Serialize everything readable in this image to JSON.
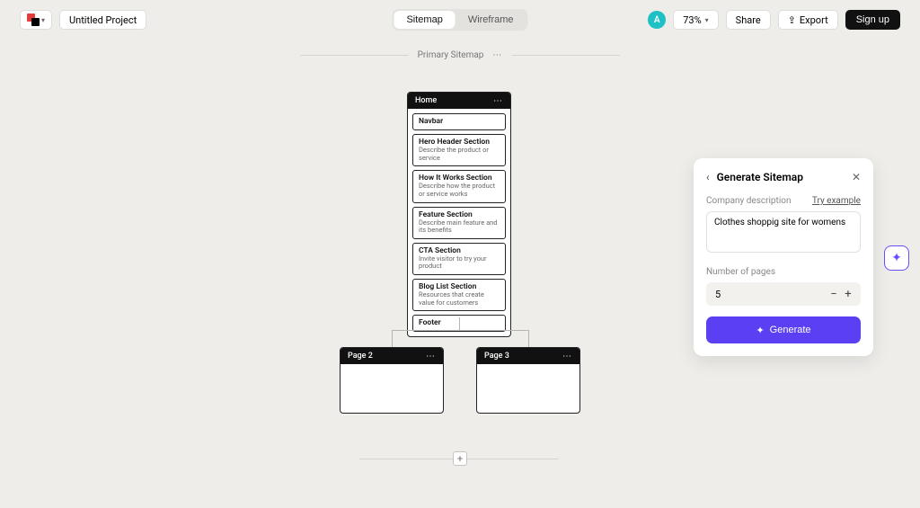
{
  "header": {
    "project_name": "Untitled Project",
    "mode_sitemap": "Sitemap",
    "mode_wireframe": "Wireframe",
    "avatar_initial": "A",
    "zoom_label": "73%",
    "share_label": "Share",
    "export_label": "Export",
    "signup_label": "Sign up"
  },
  "canvas": {
    "primary_label": "Primary Sitemap"
  },
  "home": {
    "title": "Home",
    "sections": [
      {
        "title": "Navbar",
        "desc": ""
      },
      {
        "title": "Hero Header Section",
        "desc": "Describe the product or service"
      },
      {
        "title": "How It Works Section",
        "desc": "Describe how the product or service works"
      },
      {
        "title": "Feature Section",
        "desc": "Describe main feature and its benefits"
      },
      {
        "title": "CTA Section",
        "desc": "Invite visitor to try your product"
      },
      {
        "title": "Blog List Section",
        "desc": "Resources that create value for customers"
      },
      {
        "title": "Footer",
        "desc": ""
      }
    ]
  },
  "page2": {
    "title": "Page 2"
  },
  "page3": {
    "title": "Page 3"
  },
  "panel": {
    "title": "Generate Sitemap",
    "desc_label": "Company description",
    "try_example": "Try example",
    "desc_value": "Clothes shoppig site for womens",
    "pages_label": "Number of pages",
    "pages_value": "5",
    "generate_label": "Generate"
  }
}
